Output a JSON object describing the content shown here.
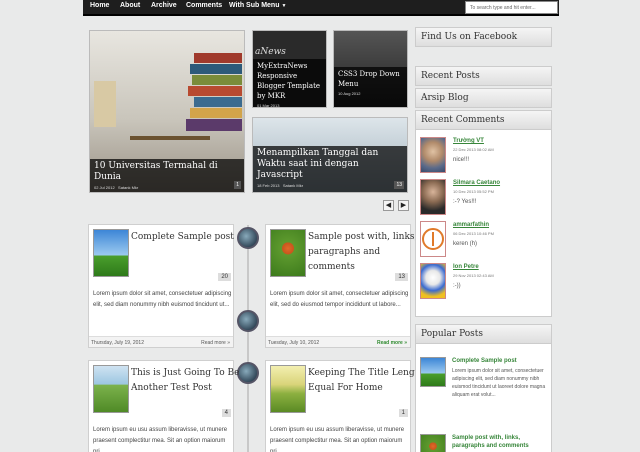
{
  "nav": {
    "items": [
      "Home",
      "About",
      "Archive",
      "Comments",
      "With Sub Menu"
    ],
    "search_placeholder": "To search type and hit enter..."
  },
  "slider": {
    "main": {
      "title": "10 Universitas Termahal di Dunia",
      "date": "02 Jul 2012",
      "author": "Satank Mkr",
      "number": "1"
    },
    "small1": {
      "brand": "aNews",
      "title": "MyExtraNews Responsive Blogger Template by MKR",
      "date": "01 Mar 2013"
    },
    "small2": {
      "title": "CSS3 Drop Down Menu",
      "date": "10 Aug 2012"
    },
    "wide": {
      "title": "Menampilkan Tanggal dan Waktu saat ini dengan Javascript",
      "date": "18 Feb 2013",
      "author": "Satank Mkr",
      "number": "13"
    },
    "prev": "◀",
    "next": "▶"
  },
  "posts": [
    {
      "title": "Complete Sample post",
      "body": "Lorem ipsum dolor sit amet, consectetuer adipiscing elit, sed diam nonummy nibh euismod tincidunt ut...",
      "date": "Thursday, July 19, 2012",
      "more": "Read more »",
      "count": "20"
    },
    {
      "title": "Sample post with, links, paragraphs and comments",
      "body": "Lorem ipsum dolor sit amet, consectetuer adipiscing elit, sed do eiusmod tempor incididunt ut labore...",
      "date": "Tuesday, July 10, 2012",
      "more": "Read more »",
      "count": "13"
    },
    {
      "title": "This is Just Going To Be Another Test Post",
      "body": "Lorem ipsum eu usu assum liberavisse, ut munere praesent complectitur mea. Sit an option maiorum pri",
      "count": "4"
    },
    {
      "title": "Keeping The Title Length Equal For Home",
      "body": "Lorem ipsum eu usu assum liberavisse, ut munere praesent complectitur mea. Sit an option maiorum pri",
      "count": "1"
    }
  ],
  "sidebar": {
    "facebook": "Find Us on Facebook",
    "recent_posts": "Recent Posts",
    "archive": "Arsip Blog",
    "recent_comments": "Recent Comments",
    "comments": [
      {
        "name": "Trường VT",
        "date": "22 Dec 2013 08:02 AM",
        "text": "nice!!!"
      },
      {
        "name": "Silmara Caetano",
        "date": "10 Dec 2013 05:52 PM",
        "text": ":-? Yes!!!"
      },
      {
        "name": "ammarfathin",
        "date": "06 Dec 2013 10:46 PM",
        "text": "keren (h)"
      },
      {
        "name": "Ion Petre",
        "date": "29 Nov 2013 02:43 AM",
        "text": ":-))"
      }
    ],
    "popular_posts": "Popular Posts",
    "popular": [
      {
        "title": "Complete Sample post",
        "text": "Lorem ipsum dolor sit amet, consectetuer adipiscing elit, sed diam nonummy nibh euismod tincidunt ut laoreet dolore magna aliquam erat volut..."
      },
      {
        "title": "Sample post with, links, paragraphs and comments"
      }
    ]
  }
}
